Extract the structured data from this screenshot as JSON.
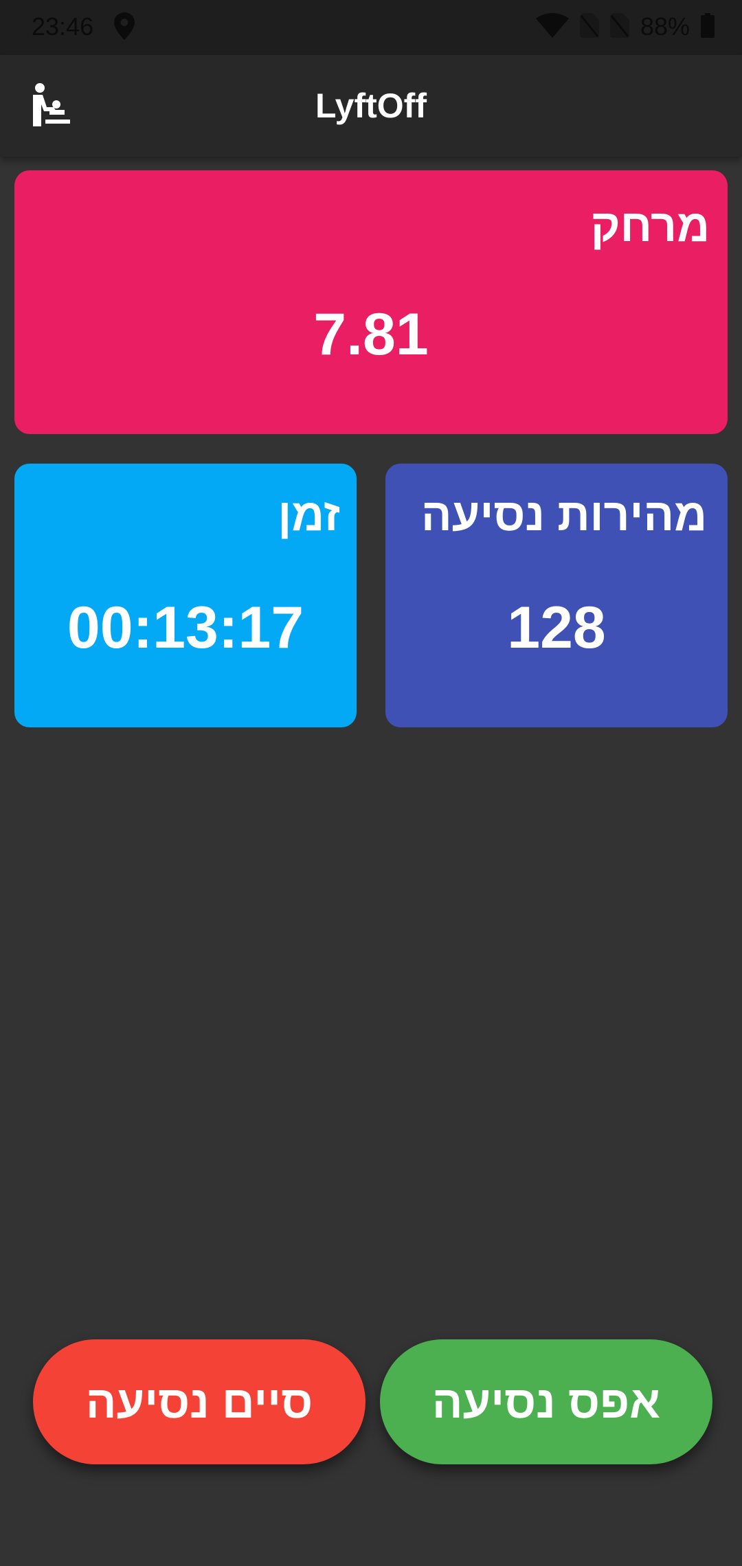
{
  "status_bar": {
    "time": "23:46",
    "battery": "88%",
    "icons": [
      "location-icon",
      "wifi-icon",
      "no-sim-icon",
      "no-sim-icon",
      "battery-icon"
    ]
  },
  "app_bar": {
    "title": "LyftOff",
    "icon": "baby-changing-station-icon"
  },
  "cards": {
    "distance": {
      "title": "מרחק",
      "value": "7.81",
      "color": "#e91e63"
    },
    "speed": {
      "title": "מהירות נסיעה",
      "value": "128",
      "color": "#3f51b5"
    },
    "time": {
      "title": "זמן",
      "value": "00:13:17",
      "color": "#03a9f4"
    }
  },
  "buttons": {
    "end_ride": {
      "label": "סיים נסיעה",
      "color": "#f44336"
    },
    "reset_ride": {
      "label": "אפס נסיעה",
      "color": "#4caf50"
    }
  }
}
